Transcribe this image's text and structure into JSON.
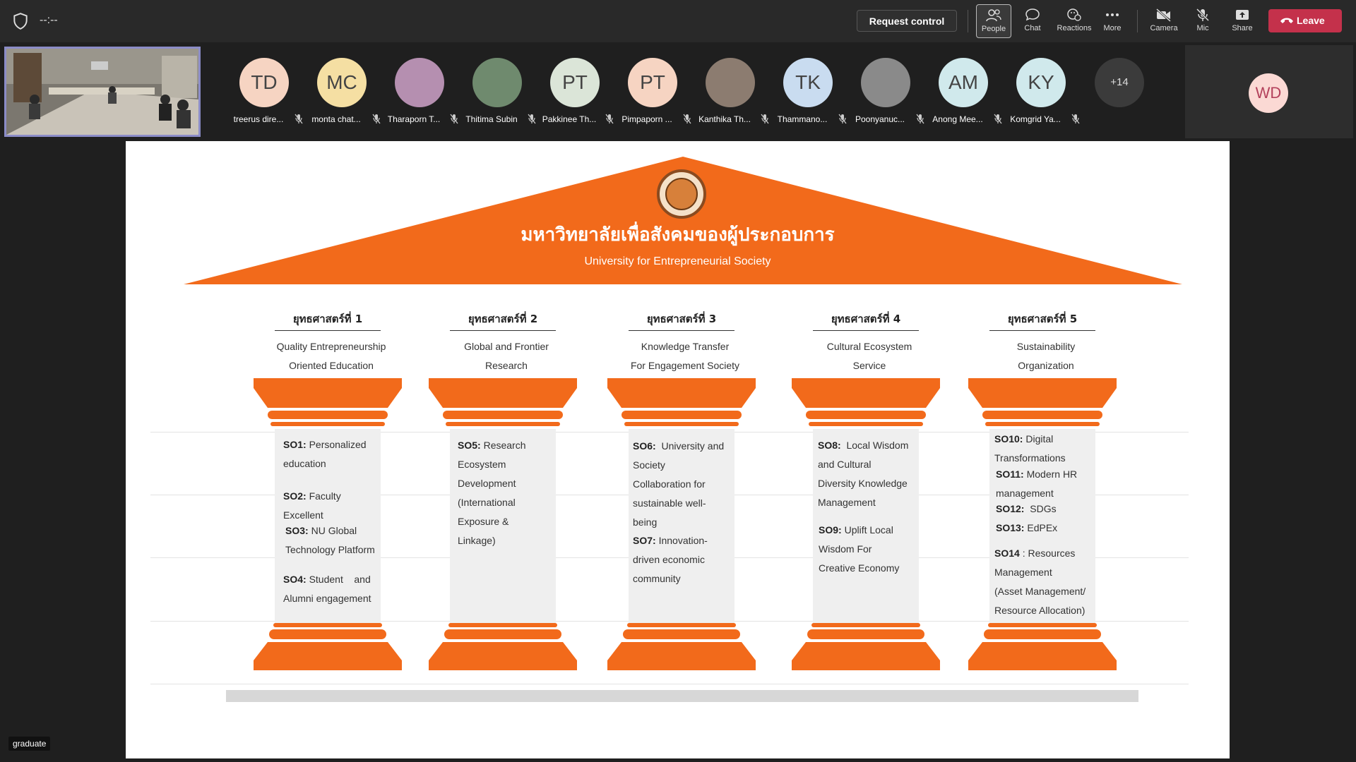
{
  "topbar": {
    "timer": "--:--",
    "request_control": "Request control",
    "buttons": {
      "people": "People",
      "chat": "Chat",
      "reactions": "Reactions",
      "more": "More",
      "camera": "Camera",
      "mic": "Mic",
      "share": "Share"
    },
    "leave": "Leave"
  },
  "participants": [
    {
      "initials": "TD",
      "name": "treerus dire...",
      "color": "#f6d4c2"
    },
    {
      "initials": "MC",
      "name": "monta chat...",
      "color": "#f5dfa3"
    },
    {
      "initials": "",
      "name": "Tharaporn T...",
      "color": "#b58fb0"
    },
    {
      "initials": "",
      "name": "Thitima Subin",
      "color": "#6f8a6e"
    },
    {
      "initials": "PT",
      "name": "Pakkinee Th...",
      "color": "#dbe5d8"
    },
    {
      "initials": "PT",
      "name": "Pimpaporn ...",
      "color": "#f6d4c2"
    },
    {
      "initials": "",
      "name": "Kanthika Th...",
      "color": "#8c7c70"
    },
    {
      "initials": "TK",
      "name": "Thammano...",
      "color": "#c9dcf0"
    },
    {
      "initials": "",
      "name": "Poonyanuc...",
      "color": "#8a8a8a"
    },
    {
      "initials": "AM",
      "name": "Anong Mee...",
      "color": "#d0e9ec"
    },
    {
      "initials": "KY",
      "name": "Komgrid Ya...",
      "color": "#d0e9ec"
    }
  ],
  "overflow_count": "+14",
  "right_participant": {
    "initials": "WD"
  },
  "slide": {
    "title_th": "มหาวิทยาลัยเพื่อสังคมของผู้ประกอบการ",
    "title_en": "University for Entrepreneurial Society",
    "pillars": [
      {
        "head": "ยุทธศาสตร์ที่ 1",
        "sub1": "Quality Entrepreneurship",
        "sub2": "Oriented Education",
        "items": [
          {
            "code": "SO1:",
            "l1": " Personalized",
            "l2": "education"
          },
          {
            "code": "SO2:",
            "l1": " Faculty",
            "l2": "Excellent"
          },
          {
            "code": "SO3:",
            "l1": " NU Global",
            "l2": "Technology Platform"
          },
          {
            "code": "SO4:",
            "l1": " Student    and",
            "l2": "Alumni engagement"
          }
        ]
      },
      {
        "head": "ยุทธศาสตร์ที่ 2",
        "sub1": "Global and Frontier",
        "sub2": "Research",
        "items": [
          {
            "code": "SO5:",
            "l1": " Research",
            "l2": "Ecosystem",
            "l3": "Development",
            "l4": "(International",
            "l5": "Exposure &",
            "l6": "Linkage)"
          }
        ]
      },
      {
        "head": "ยุทธศาสตร์ที่ 3",
        "sub1": "Knowledge Transfer",
        "sub2": "For Engagement Society",
        "items": [
          {
            "code": "SO6:",
            "l1": "  University and",
            "l2": "Society",
            "l3": "Collaboration for",
            "l4": "sustainable well-",
            "l5": "being"
          },
          {
            "code": "SO7:",
            "l1": " Innovation-",
            "l2": "driven economic",
            "l3": "community"
          }
        ]
      },
      {
        "head": "ยุทธศาสตร์ที่ 4",
        "sub1": "Cultural Ecosystem",
        "sub2": "Service",
        "items": [
          {
            "code": "SO8:",
            "l1": "  Local Wisdom",
            "l2": "and Cultural",
            "l3": "Diversity Knowledge",
            "l4": "Management"
          },
          {
            "code": "SO9:",
            "l1": " Uplift Local",
            "l2": "Wisdom For",
            "l3": "Creative Economy"
          }
        ]
      },
      {
        "head": "ยุทธศาสตร์ที่ 5",
        "sub1": "Sustainability",
        "sub2": "Organization",
        "items": [
          {
            "code": "SO10:",
            "l1": " Digital",
            "l2": "Transformations"
          },
          {
            "code": "SO11:",
            "l1": " Modern HR",
            "l2": "management"
          },
          {
            "code": "SO12:",
            "l1": "  SDGs"
          },
          {
            "code": "SO13:",
            "l1": " EdPEx"
          },
          {
            "code": "SO14",
            "l1": " : Resources",
            "l2": "Management",
            "l3": "(Asset Management/",
            "l4": "Resource Allocation)"
          }
        ]
      }
    ]
  },
  "tag": "graduate",
  "colors": {
    "accent": "#f26a1b",
    "leave": "#c4314b",
    "highlight": "#8b8cc7"
  }
}
